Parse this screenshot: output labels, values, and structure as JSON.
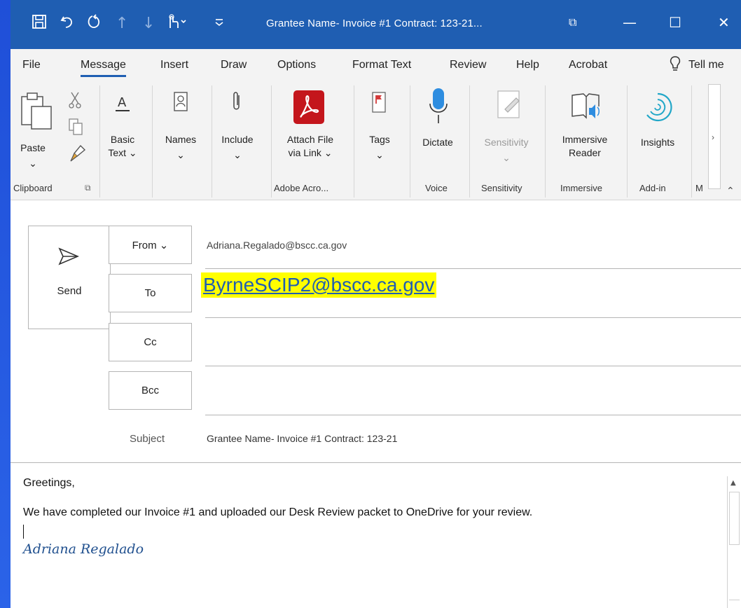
{
  "window": {
    "title": "Grantee Name- Invoice #1 Contract: 123-21...",
    "controls": {
      "restore": "⧉",
      "minimize": "—",
      "maximize": "☐",
      "close": "✕"
    }
  },
  "quick_access": [
    "save-icon",
    "undo-icon",
    "redo-icon",
    "up-arrow-icon",
    "down-arrow-icon",
    "touch-mode-icon",
    "customize-icon"
  ],
  "menu": {
    "tabs": [
      "File",
      "Message",
      "Insert",
      "Draw",
      "Options",
      "Format Text",
      "Review",
      "Help",
      "Acrobat",
      "Tell me"
    ],
    "active": "Message"
  },
  "ribbon": {
    "paste": "Paste",
    "basic_text": "Basic\nText ⌄",
    "names": "Names",
    "include": "Include",
    "attach": "Attach File\nvia Link ⌄",
    "tags": "Tags",
    "dictate": "Dictate",
    "sensitivity": "Sensitivity",
    "immersive_reader": "Immersive\nReader",
    "insights": "Insights",
    "groups": {
      "clipboard": "Clipboard",
      "adobe": "Adobe Acro...",
      "voice": "Voice",
      "sensitivity": "Sensitivity",
      "immersive": "Immersive",
      "addin": "Add-in",
      "my": "M"
    },
    "colors": {
      "adobe_red": "#c4161c",
      "mic_blue": "#2e8de0",
      "insights_teal": "#22a7c8",
      "tag_red": "#d33b3b"
    }
  },
  "header": {
    "send_label": "Send",
    "from_label": "From ⌄",
    "from_value": "Adriana.Regalado@bscc.ca.gov",
    "to_label": "To",
    "to_value": "ByrneSCIP2@bscc.ca.gov",
    "cc_label": "Cc",
    "bcc_label": "Bcc",
    "subject_label": "Subject",
    "subject_value": "Grantee Name- Invoice #1 Contract: 123-21",
    "highlight_color": "#ffff00",
    "link_color": "#1f5eb2"
  },
  "body": {
    "greeting": "Greetings,",
    "message": "We have completed our Invoice #1 and uploaded our Desk Review packet to OneDrive for your review.",
    "signature": "Adriana Regalado"
  }
}
